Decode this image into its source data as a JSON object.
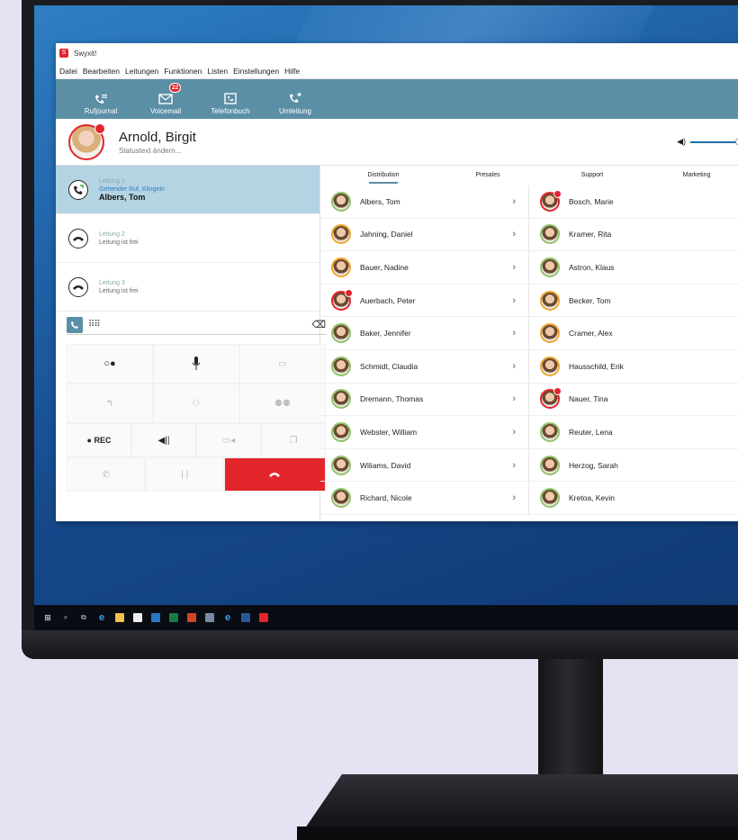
{
  "app": {
    "title": "Swyxit!",
    "logo_glyph": "S",
    "accent": "#5b8fa6",
    "red": "#e2262b"
  },
  "menu": [
    "Datei",
    "Bearbeiten",
    "Leitungen",
    "Funktionen",
    "Listen",
    "Einstellungen",
    "Hilfe"
  ],
  "toolbar": {
    "items": [
      {
        "label": "Rufjournal",
        "icon": "call-journal-icon"
      },
      {
        "label": "Voicemail",
        "icon": "voicemail-icon",
        "badge": "22"
      },
      {
        "label": "Telefonbuch",
        "icon": "phonebook-icon"
      },
      {
        "label": "Umleitung",
        "icon": "forwarding-icon"
      }
    ]
  },
  "user": {
    "name": "Arnold, Birgit",
    "status": "Statustext ändern..."
  },
  "lines": [
    {
      "label": "Leitung 1",
      "state": "Gehender Ruf, Klingeln",
      "caller": "Albers, Tom",
      "active": true
    },
    {
      "label": "Leitung 2",
      "state": "Leitung ist frei"
    },
    {
      "label": "Leitung 3",
      "state": "Leitung ist frei"
    }
  ],
  "controls": {
    "rec": "● REC",
    "pause": "| |"
  },
  "tabs": [
    "Distribution",
    "Presales",
    "Support",
    "Marketing"
  ],
  "contacts": {
    "left": [
      {
        "name": "Albers, Tom",
        "status": "available"
      },
      {
        "name": "Jahning, Daniel",
        "status": "away"
      },
      {
        "name": "Bauer, Nadine",
        "status": "away"
      },
      {
        "name": "Auerbach, Peter",
        "status": "busy"
      },
      {
        "name": "Baker, Jennifer",
        "status": "available"
      },
      {
        "name": "Schmidt, Claudia",
        "status": "available"
      },
      {
        "name": "Dremann, Thomas",
        "status": "available"
      },
      {
        "name": "Webster, William",
        "status": "available"
      },
      {
        "name": "Wiliams, David",
        "status": "available"
      },
      {
        "name": "Richard, Nicole",
        "status": "available"
      }
    ],
    "right": [
      {
        "name": "Bosch, Marie",
        "status": "busy"
      },
      {
        "name": "Kramer, Rita",
        "status": "available"
      },
      {
        "name": "Astron, Klaus",
        "status": "available"
      },
      {
        "name": "Becker, Tom",
        "status": "away"
      },
      {
        "name": "Cramer, Alex",
        "status": "away"
      },
      {
        "name": "Hausschild, Erik",
        "status": "away"
      },
      {
        "name": "Nauer, Tina",
        "status": "busy"
      },
      {
        "name": "Reuter, Lena",
        "status": "available"
      },
      {
        "name": "Herzog, Sarah",
        "status": "available"
      },
      {
        "name": "Kretoa, Kevin",
        "status": "available"
      }
    ]
  }
}
